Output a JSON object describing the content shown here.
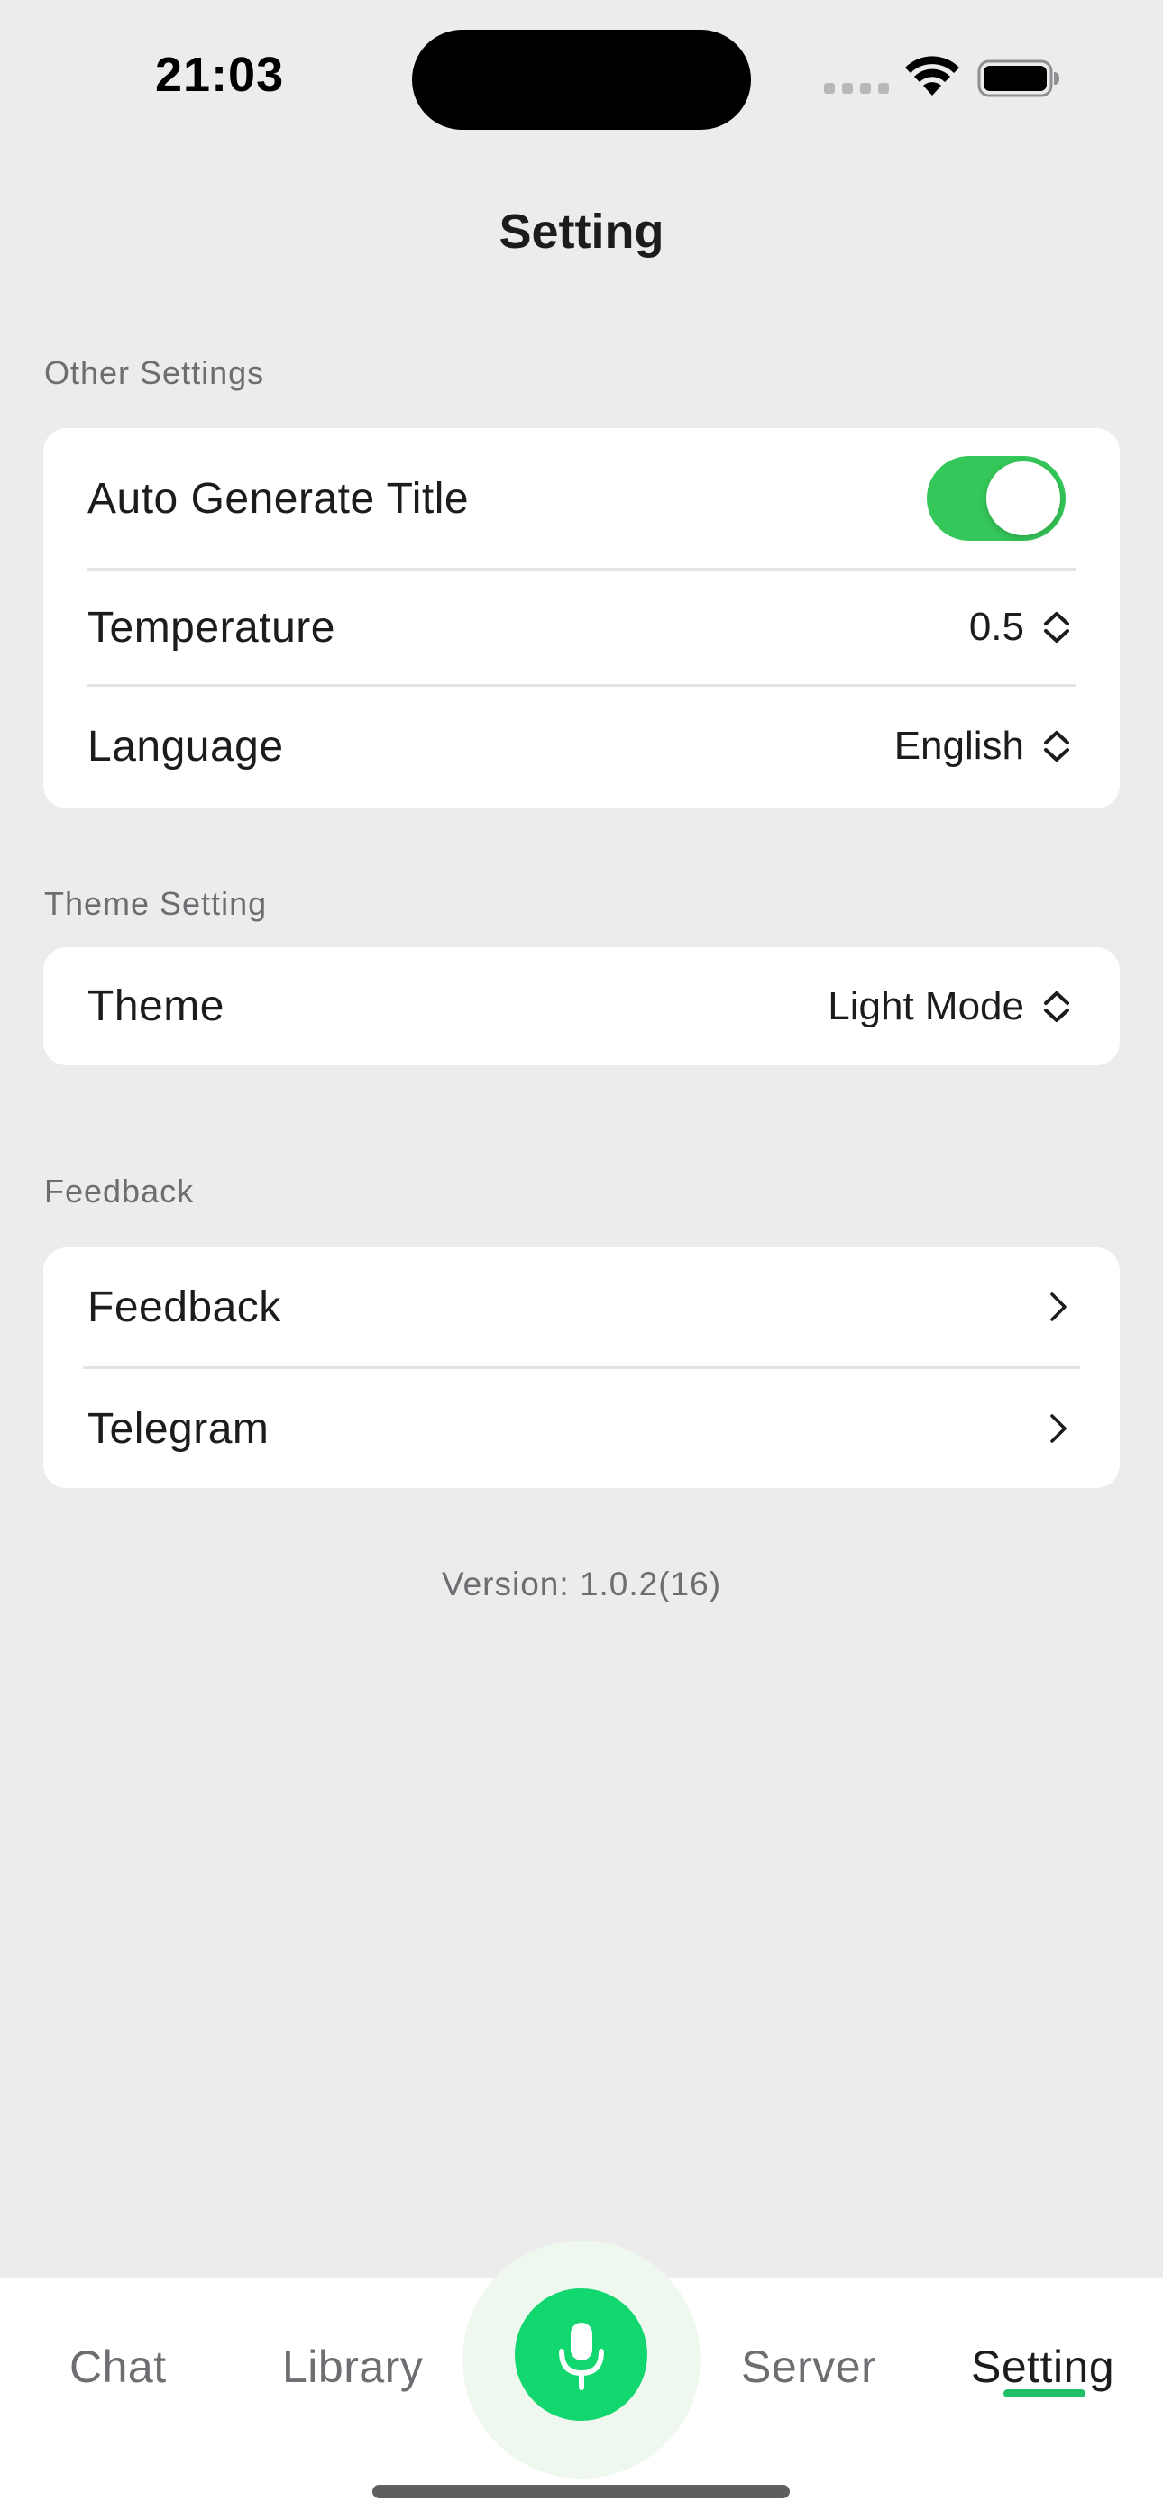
{
  "status_bar": {
    "time": "21:03"
  },
  "header": {
    "title": "Setting"
  },
  "sections": {
    "other": {
      "header": "Other Settings",
      "auto_title": {
        "label": "Auto Generate Title",
        "enabled": true
      },
      "temperature": {
        "label": "Temperature",
        "value": "0.5"
      },
      "language": {
        "label": "Language",
        "value": "English"
      }
    },
    "theme": {
      "header": "Theme Setting",
      "theme_row": {
        "label": "Theme",
        "value": "Light Mode"
      }
    },
    "feedback": {
      "header": "Feedback",
      "feedback_row": {
        "label": "Feedback"
      },
      "telegram_row": {
        "label": "Telegram"
      }
    }
  },
  "version_text": "Version: 1.0.2(16)",
  "tab_bar": {
    "tabs": [
      {
        "label": "Chat"
      },
      {
        "label": "Library"
      },
      {
        "label": "Server"
      },
      {
        "label": "Setting"
      }
    ],
    "active_tab": "Setting",
    "mic_icon": "microphone-icon"
  },
  "colors": {
    "accent_green": "#12d66e",
    "toggle_green": "#34c759",
    "background": "#ececec",
    "card": "#ffffff"
  }
}
